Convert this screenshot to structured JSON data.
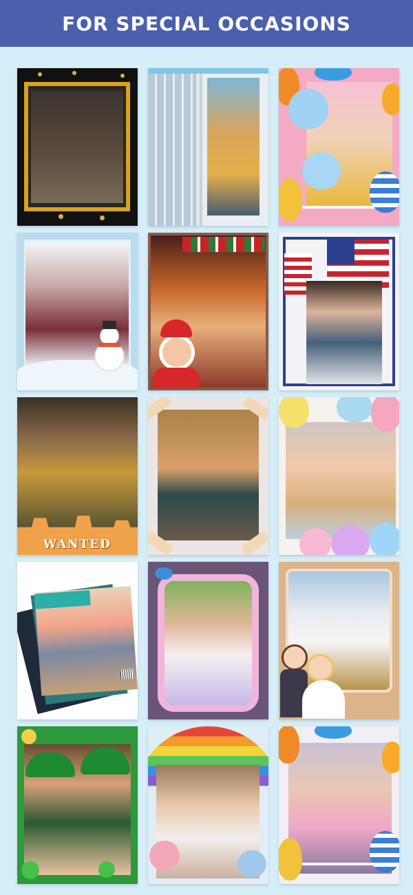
{
  "header": {
    "title": "FOR SPECIAL OCCASIONS"
  },
  "colors": {
    "header_bg": "#4b5fac",
    "page_bg": "#d6eef8",
    "header_text": "#ffffff"
  },
  "frames": [
    {
      "id": "party-gold-frame",
      "theme": "party"
    },
    {
      "id": "billboard-frame",
      "theme": "billboard"
    },
    {
      "id": "birthday-balloons-frame",
      "theme": "birthday"
    },
    {
      "id": "winter-snowman-frame",
      "theme": "winter"
    },
    {
      "id": "christmas-santa-frame",
      "theme": "christmas"
    },
    {
      "id": "usa-flag-frame",
      "theme": "independence-day"
    },
    {
      "id": "wanted-western-frame",
      "theme": "western",
      "label": "WANTED"
    },
    {
      "id": "vintage-taped-frame",
      "theme": "vintage"
    },
    {
      "id": "easter-eggs-frame",
      "theme": "easter"
    },
    {
      "id": "magazine-stack-frame",
      "theme": "magazine"
    },
    {
      "id": "princess-ornate-frame",
      "theme": "princess"
    },
    {
      "id": "wedding-cartoon-frame",
      "theme": "wedding"
    },
    {
      "id": "st-patricks-frame",
      "theme": "st-patricks"
    },
    {
      "id": "rainbow-frame",
      "theme": "rainbow"
    },
    {
      "id": "birthday-party-frame",
      "theme": "birthday-party"
    }
  ]
}
